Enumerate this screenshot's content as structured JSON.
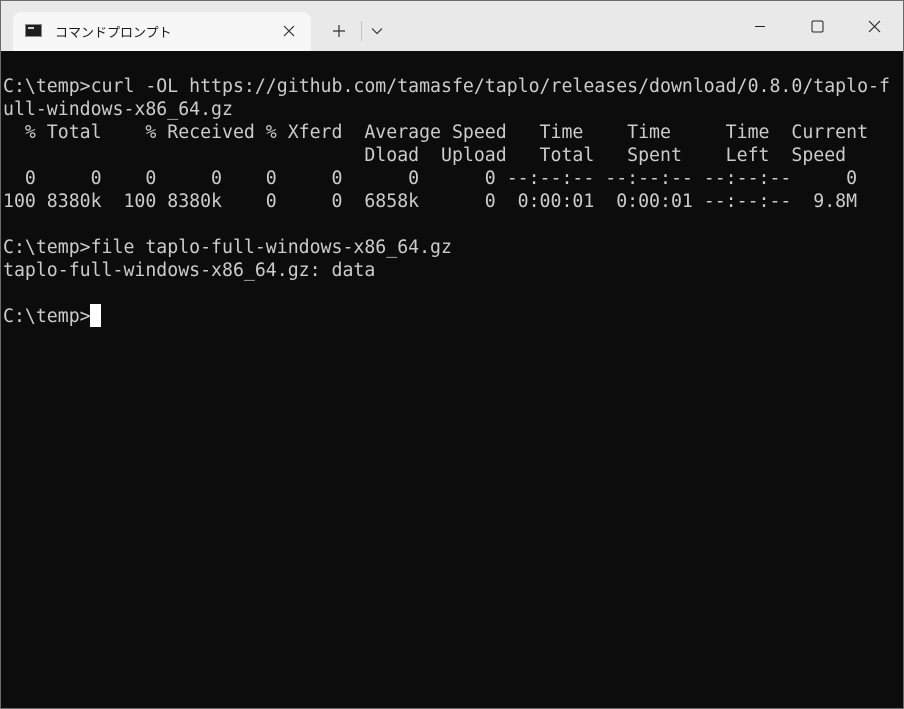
{
  "window": {
    "tab_title": "コマンドプロンプト",
    "icons": {
      "tab": "command-prompt-icon",
      "tab_close": "close-icon",
      "new_tab": "plus-icon",
      "dropdown": "chevron-down-icon",
      "minimize": "minimize-icon",
      "maximize": "maximize-icon",
      "close": "close-icon"
    }
  },
  "terminal": {
    "background": "#0c0c0c",
    "foreground": "#cccccc",
    "lines": [
      "C:\\temp>curl -OL https://github.com/tamasfe/taplo/releases/download/0.8.0/taplo-f",
      "ull-windows-x86_64.gz",
      "  % Total    % Received % Xferd  Average Speed   Time    Time     Time  Current",
      "                                 Dload  Upload   Total   Spent    Left  Speed",
      "  0     0    0     0    0     0      0      0 --:--:-- --:--:-- --:--:--     0",
      "100 8380k  100 8380k    0     0  6858k      0  0:00:01  0:00:01 --:--:--  9.8M",
      "",
      "C:\\temp>file taplo-full-windows-x86_64.gz",
      "taplo-full-windows-x86_64.gz: data",
      "",
      "C:\\temp>"
    ]
  }
}
